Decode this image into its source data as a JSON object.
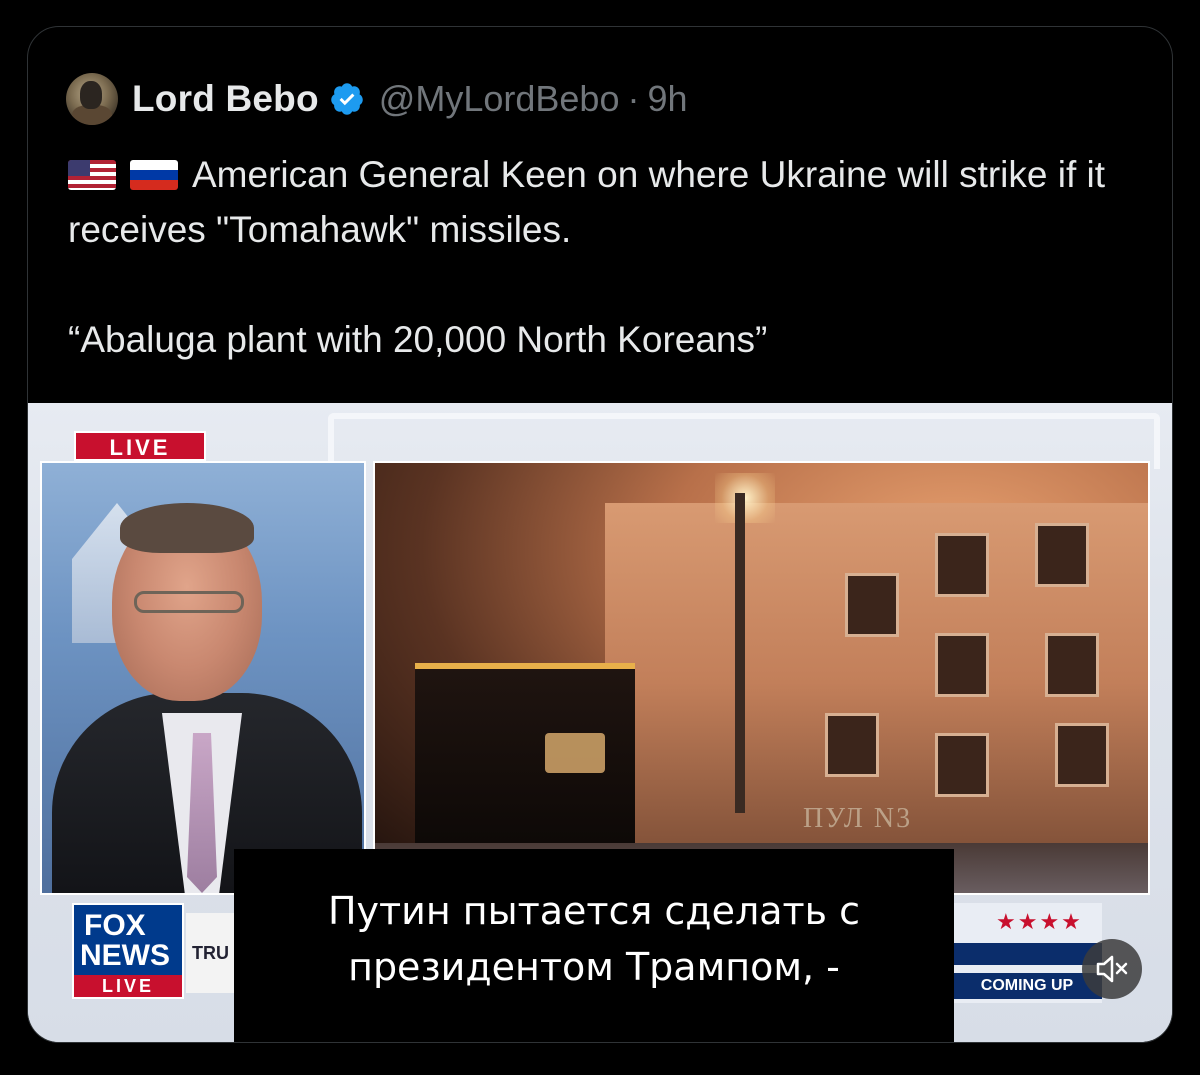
{
  "tweet": {
    "author_name": "Lord Bebo",
    "handle": "@MyLordBebo",
    "separator": "·",
    "time": "9h",
    "flags": [
      "us-flag-icon",
      "russia-flag-icon"
    ],
    "text_line1": "American General Keen on where Ukraine will strike if it receives \"Tomahawk\" missiles.",
    "text_line2": "“Abaluga plant with 20,000 North Koreans”"
  },
  "video": {
    "live_tag": "LIVE",
    "fox_logo_top": "FOX",
    "fox_logo_middle": "NEWS",
    "fox_logo_bottom": "LIVE",
    "lower_third_fragment": "TRU",
    "coming_up": "COMING UP",
    "stars": "★★★★",
    "watermark": "ПУЛ N3",
    "subtitle_line1": "Путин пытается сделать с",
    "subtitle_line2": "президентом Трампом, -",
    "mute_icon": "speaker-muted-icon"
  },
  "colors": {
    "background": "#000000",
    "text": "#e7e9ea",
    "muted": "#71767b",
    "verified": "#1d9bf0",
    "fox_red": "#c8102e",
    "fox_blue": "#003a8c"
  }
}
